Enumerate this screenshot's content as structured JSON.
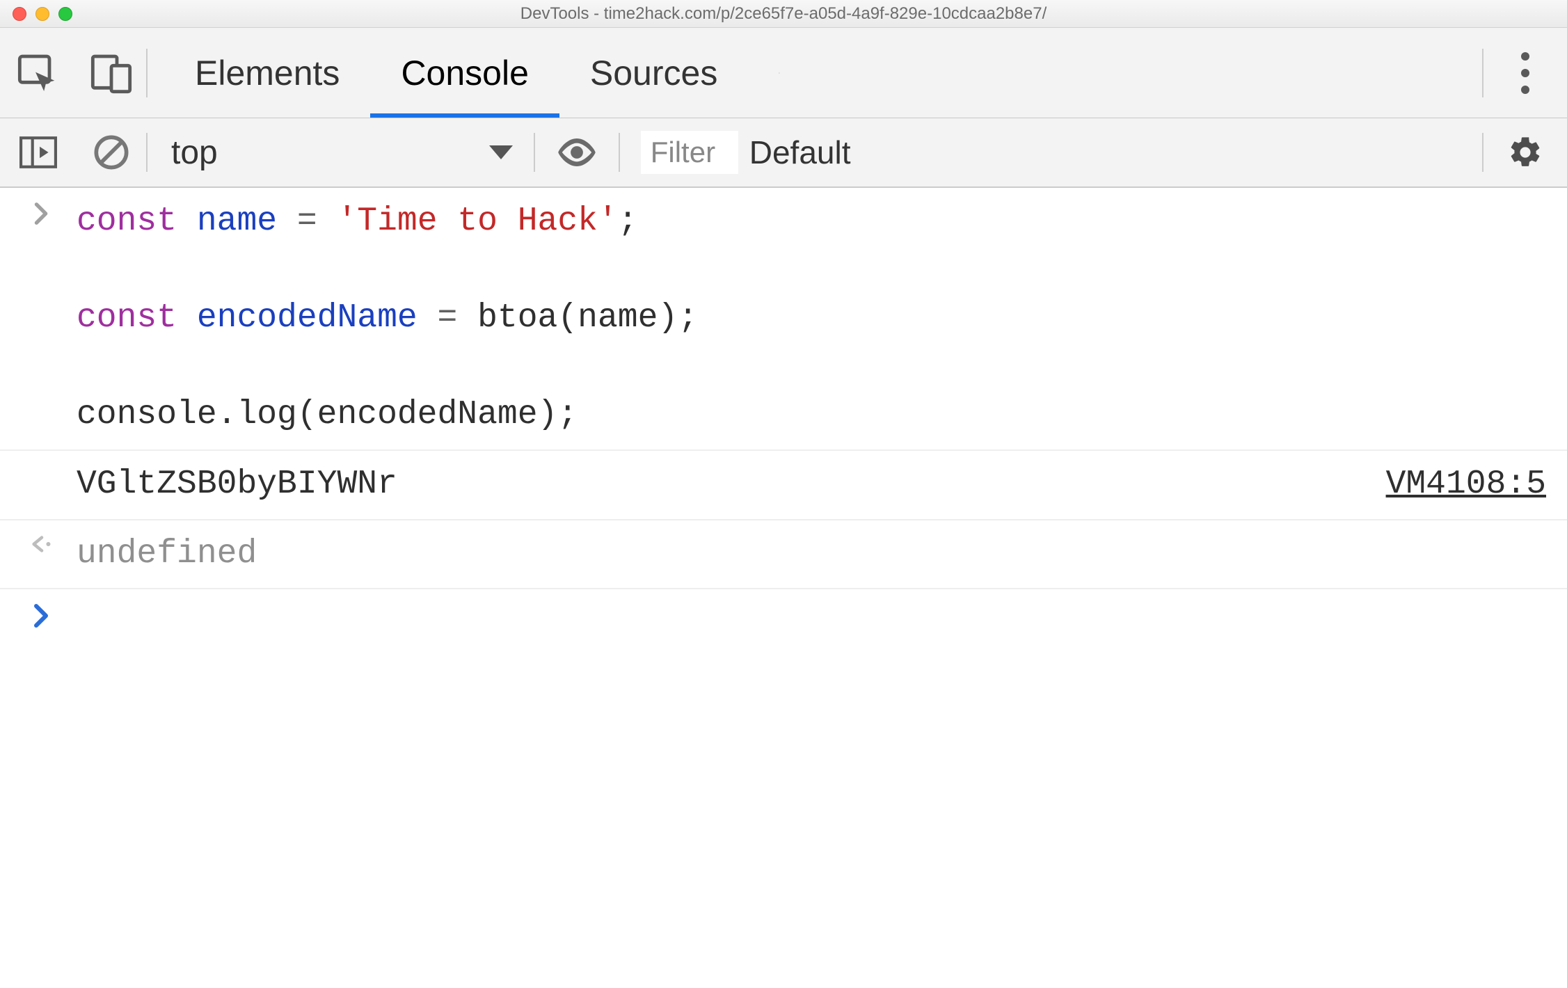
{
  "window": {
    "title": "DevTools - time2hack.com/p/2ce65f7e-a05d-4a9f-829e-10cdcaa2b8e7/"
  },
  "tabs": {
    "elements": "Elements",
    "console": "Console",
    "sources": "Sources"
  },
  "toolbar": {
    "context": "top",
    "filter_placeholder": "Filter",
    "levels_label": "Default"
  },
  "console": {
    "code_line1_kw": "const",
    "code_line1_ident": "name",
    "code_line1_op": "=",
    "code_line1_str": "'Time to Hack'",
    "code_line1_end": ";",
    "code_line2_kw": "const",
    "code_line2_ident": "encodedName",
    "code_line2_op": "=",
    "code_line2_call": "btoa(name);",
    "code_line3": "console.log(encodedName);",
    "log_output": "VGltZSB0byBIYWNr",
    "log_source": "VM4108:5",
    "return_value": "undefined"
  }
}
